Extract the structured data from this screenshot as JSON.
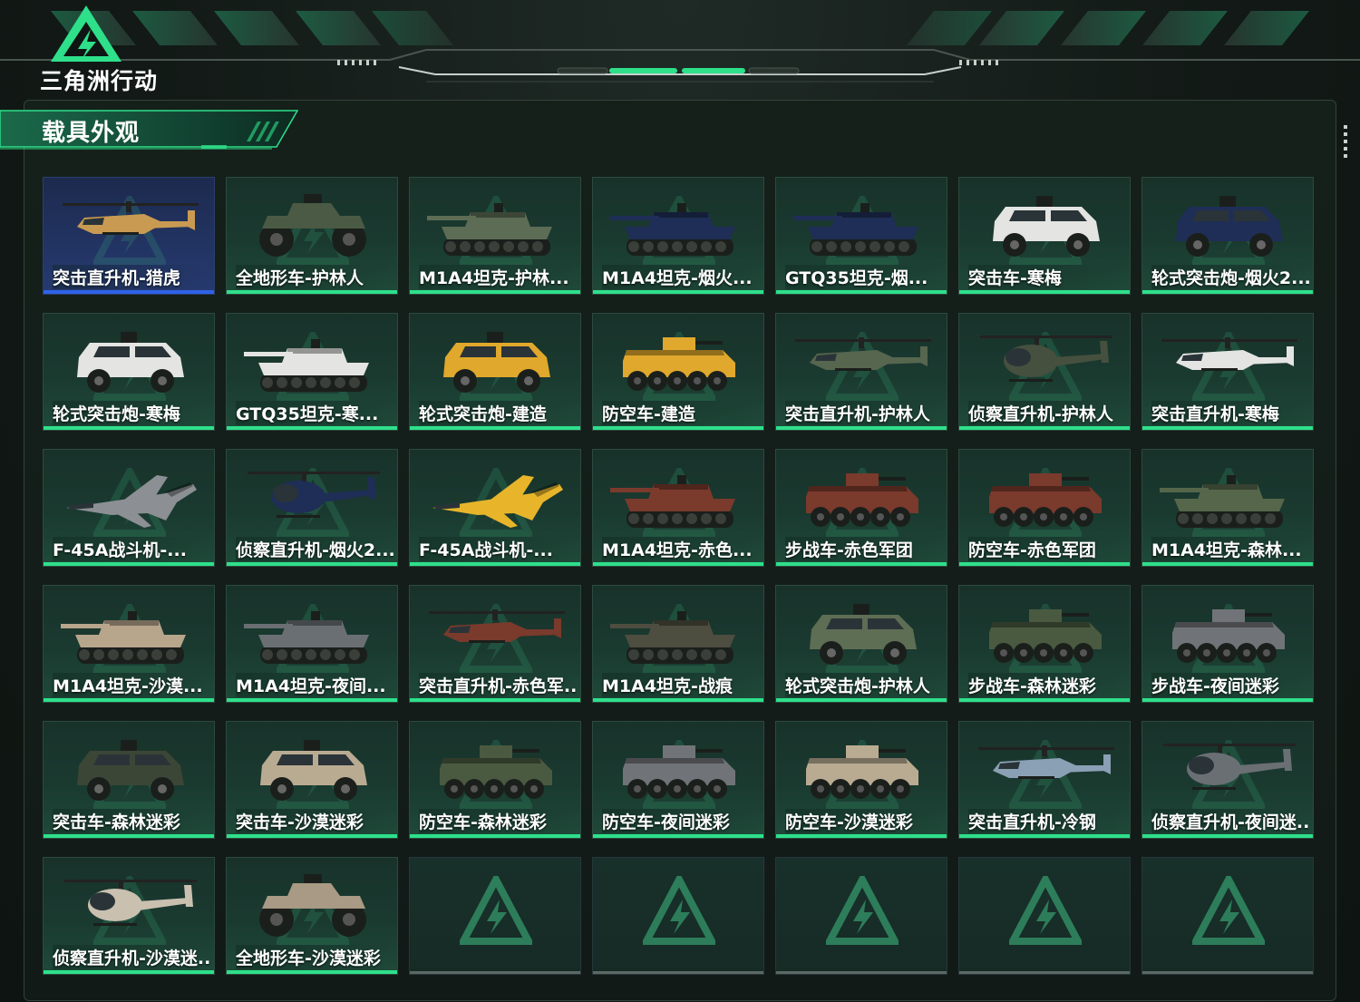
{
  "app": {
    "logo_text": "三角洲行动"
  },
  "section": {
    "title": "载具外观"
  },
  "colors": {
    "accent_green": "#2ee08a",
    "selected_blue": "#2f62e8",
    "background": "#121916"
  },
  "items": [
    {
      "label": "突击直升机-猎虎",
      "kind": "heli",
      "color": "#c99a52",
      "selected": true
    },
    {
      "label": "全地形车-护林人",
      "kind": "atv",
      "color": "#4a5a44"
    },
    {
      "label": "M1A4坦克-护林...",
      "kind": "tank",
      "color": "#5d6c55"
    },
    {
      "label": "M1A4坦克-烟火...",
      "kind": "tank",
      "color": "#1f2e56"
    },
    {
      "label": "GTQ35坦克-烟...",
      "kind": "tank",
      "color": "#1f2e56"
    },
    {
      "label": "突击车-寒梅",
      "kind": "truck",
      "color": "#e4e4e2"
    },
    {
      "label": "轮式突击炮-烟火2...",
      "kind": "truck",
      "color": "#1f2e56"
    },
    {
      "label": "轮式突击炮-寒梅",
      "kind": "truck",
      "color": "#e4e4e2"
    },
    {
      "label": "GTQ35坦克-寒...",
      "kind": "tank",
      "color": "#e4e4e2"
    },
    {
      "label": "轮式突击炮-建造",
      "kind": "truck",
      "color": "#e0a82c"
    },
    {
      "label": "防空车-建造",
      "kind": "apc",
      "color": "#e0a82c"
    },
    {
      "label": "突击直升机-护林人",
      "kind": "heli",
      "color": "#56664f"
    },
    {
      "label": "侦察直升机-护林人",
      "kind": "smallheli",
      "color": "#45503f"
    },
    {
      "label": "突击直升机-寒梅",
      "kind": "heli",
      "color": "#e4e4e2"
    },
    {
      "label": "F-45A战斗机-...",
      "kind": "jet",
      "color": "#8c8f93"
    },
    {
      "label": "侦察直升机-烟火2...",
      "kind": "smallheli",
      "color": "#1f2e56"
    },
    {
      "label": "F-45A战斗机-...",
      "kind": "jet",
      "color": "#e8b52a"
    },
    {
      "label": "M1A4坦克-赤色...",
      "kind": "tank",
      "color": "#7a3a2c"
    },
    {
      "label": "步战车-赤色军团",
      "kind": "apc",
      "color": "#7a3a2c"
    },
    {
      "label": "防空车-赤色军团",
      "kind": "apc",
      "color": "#7a3a2c"
    },
    {
      "label": "M1A4坦克-森林...",
      "kind": "tank",
      "color": "#55664a"
    },
    {
      "label": "M1A4坦克-沙漠...",
      "kind": "tank",
      "color": "#b7a58c"
    },
    {
      "label": "M1A4坦克-夜间...",
      "kind": "tank",
      "color": "#6a6f74"
    },
    {
      "label": "突击直升机-赤色军...",
      "kind": "heli",
      "color": "#7a3a2c"
    },
    {
      "label": "M1A4坦克-战痕",
      "kind": "tank",
      "color": "#4d4d40"
    },
    {
      "label": "轮式突击炮-护林人",
      "kind": "truck",
      "color": "#5e6e55"
    },
    {
      "label": "步战车-森林迷彩",
      "kind": "apc",
      "color": "#4a5a40"
    },
    {
      "label": "步战车-夜间迷彩",
      "kind": "apc",
      "color": "#707478"
    },
    {
      "label": "突击车-森林迷彩",
      "kind": "truck",
      "color": "#3c4636"
    },
    {
      "label": "突击车-沙漠迷彩",
      "kind": "truck",
      "color": "#b9ab92"
    },
    {
      "label": "防空车-森林迷彩",
      "kind": "apc",
      "color": "#4a5a40"
    },
    {
      "label": "防空车-夜间迷彩",
      "kind": "apc",
      "color": "#707478"
    },
    {
      "label": "防空车-沙漠迷彩",
      "kind": "apc",
      "color": "#b9ab92"
    },
    {
      "label": "突击直升机-冷钢",
      "kind": "heli",
      "color": "#8aa0b4"
    },
    {
      "label": "侦察直升机-夜间迷...",
      "kind": "smallheli",
      "color": "#6a6f74"
    },
    {
      "label": "侦察直升机-沙漠迷...",
      "kind": "smallheli",
      "color": "#c9c0b0"
    },
    {
      "label": "全地形车-沙漠迷彩",
      "kind": "atv",
      "color": "#a89a84"
    }
  ],
  "empty_slots": 5
}
